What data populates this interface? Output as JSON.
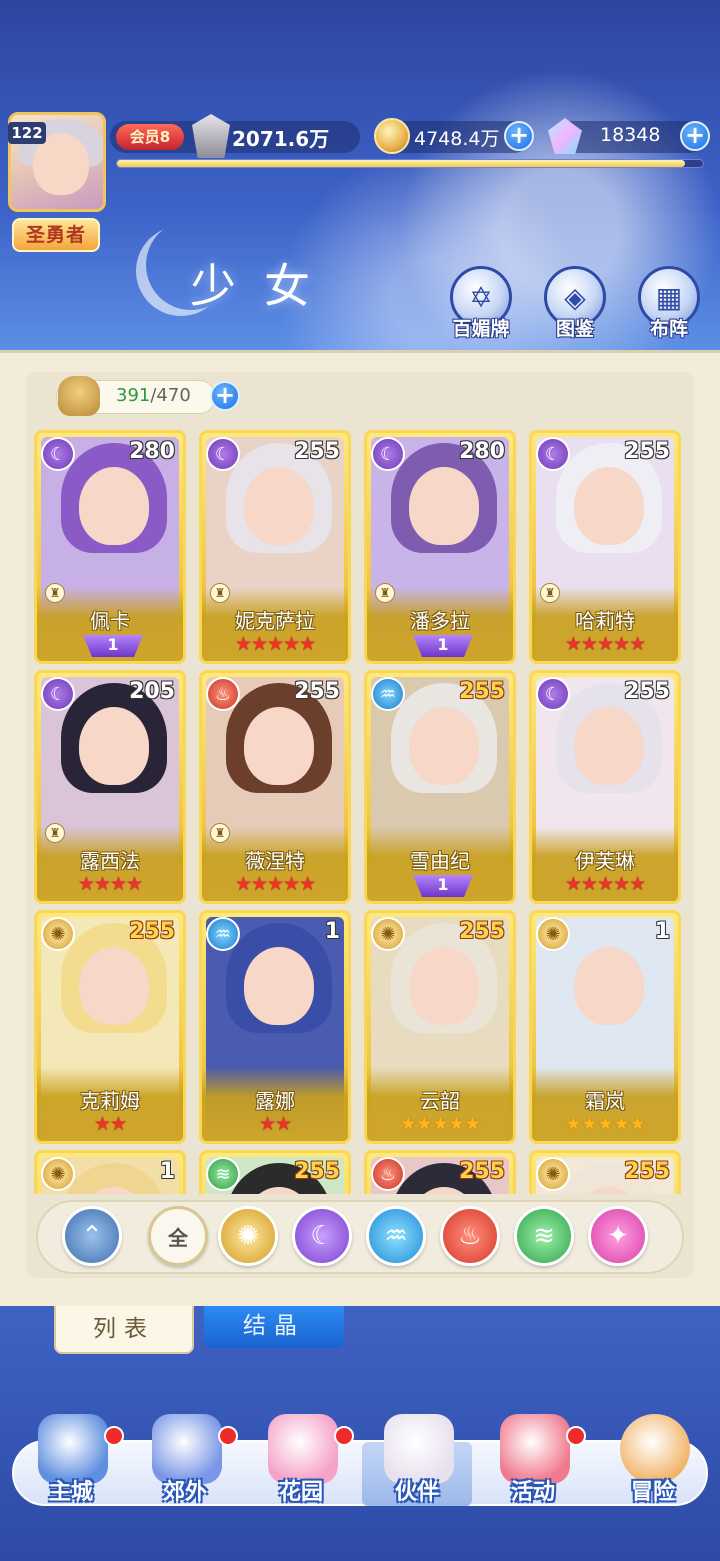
{
  "player": {
    "level": "122",
    "title": "圣勇者",
    "vip": "会员8",
    "power": "2071.6万",
    "xp_fraction": 0.97
  },
  "resources": {
    "gold": "4748.4万",
    "gems": "18348"
  },
  "page": {
    "title": "少女",
    "top_buttons": [
      "百媚牌",
      "图鉴",
      "布阵"
    ]
  },
  "roster": {
    "current": "391",
    "max": "/470"
  },
  "cards": [
    {
      "name": "佩卡",
      "level": "280",
      "element": "moon",
      "tier": "1",
      "stars": 0,
      "max": false
    },
    {
      "name": "妮克萨拉",
      "level": "255",
      "element": "moon",
      "tier": "",
      "stars": 5,
      "max": false
    },
    {
      "name": "潘多拉",
      "level": "280",
      "element": "moon",
      "tier": "1",
      "stars": 0,
      "max": false
    },
    {
      "name": "哈莉特",
      "level": "255",
      "element": "moon",
      "tier": "",
      "stars": 5,
      "max": false
    },
    {
      "name": "露西法",
      "level": "205",
      "element": "moon",
      "tier": "",
      "stars": 4,
      "max": false
    },
    {
      "name": "薇涅特",
      "level": "255",
      "element": "fire",
      "tier": "",
      "stars": 5,
      "max": false
    },
    {
      "name": "雪由纪",
      "level": "255",
      "element": "water",
      "tier": "1",
      "stars": 0,
      "max": true
    },
    {
      "name": "伊芙琳",
      "level": "255",
      "element": "moon",
      "tier": "",
      "stars": 5,
      "max": false
    },
    {
      "name": "克莉姆",
      "level": "255",
      "element": "sun",
      "tier": "",
      "stars": 2,
      "max": true
    },
    {
      "name": "露娜",
      "level": "1",
      "element": "water",
      "tier": "",
      "stars": 2,
      "max": false
    },
    {
      "name": "云韶",
      "level": "255",
      "element": "sun",
      "tier": "",
      "stars": 5,
      "max": true,
      "gold_stars": true
    },
    {
      "name": "霜岚",
      "level": "1",
      "element": "sun",
      "tier": "",
      "stars": 5,
      "max": false,
      "gold_stars": true
    },
    {
      "name": "",
      "level": "1",
      "element": "sun",
      "tier": "",
      "stars": 0,
      "max": false
    },
    {
      "name": "",
      "level": "255",
      "element": "wind",
      "tier": "",
      "stars": 0,
      "max": true
    },
    {
      "name": "",
      "level": "255",
      "element": "fire",
      "tier": "",
      "stars": 0,
      "max": true
    },
    {
      "name": "",
      "level": "255",
      "element": "sun",
      "tier": "",
      "stars": 0,
      "max": true
    }
  ],
  "filters": {
    "all_label": "全",
    "icons": [
      "sort-icon",
      "all",
      "sun-icon",
      "moon-icon",
      "water-icon",
      "fire-icon",
      "wind-icon",
      "star-icon"
    ]
  },
  "tabs": {
    "list": "列表",
    "crystal": "结晶"
  },
  "nav": [
    "主城",
    "郊外",
    "花园",
    "伙伴",
    "活动",
    "冒险"
  ],
  "colors": {
    "card_gold": "#f2c93c",
    "panel": "#f3ecd9",
    "accent_blue": "#1e6fe0"
  }
}
